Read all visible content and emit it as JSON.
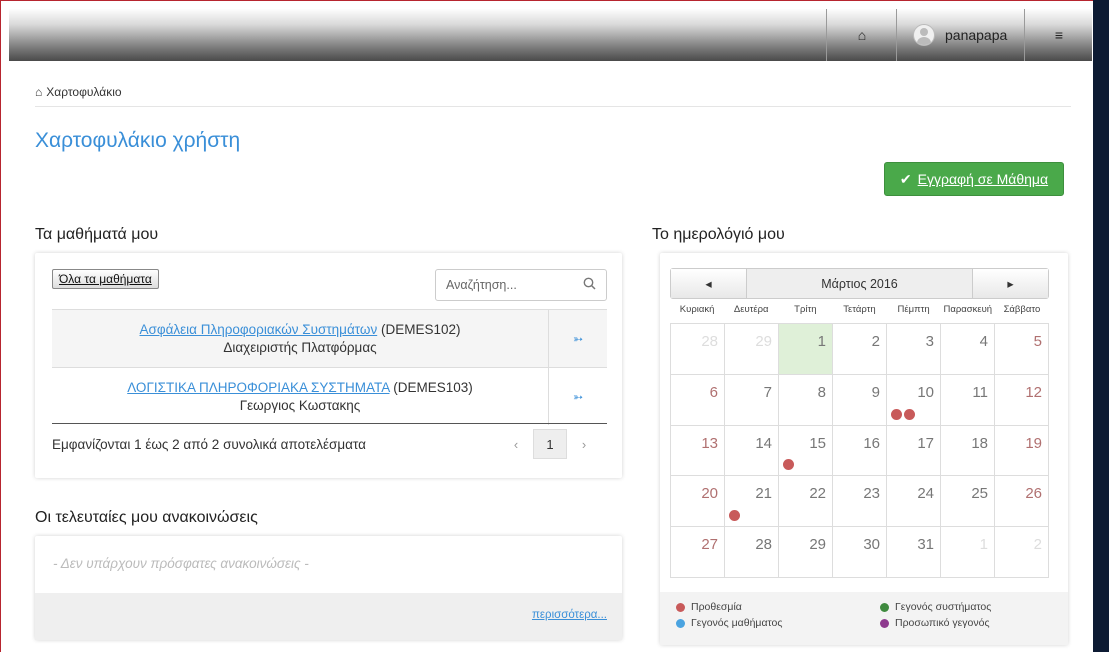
{
  "topbar": {
    "home_icon": "home-icon",
    "username": "panapapa",
    "settings_icon": "sliders-icon"
  },
  "breadcrumb": {
    "label": "Χαρτοφυλάκιο"
  },
  "page_title": "Χαρτοφυλάκιο χρήστη",
  "enroll_button": "Εγγραφή σε Μάθημα",
  "courses": {
    "heading": "Τα μαθήματά μου",
    "all_button": "Όλα τα μαθήματα",
    "search_placeholder": "Αναζήτηση...",
    "rows": [
      {
        "title": "Ασφάλεια Πληροφοριακών Συστημάτων",
        "code": "(DEMES102)",
        "instructor": "Διαχειριστής Πλατφόρμας"
      },
      {
        "title": "ΛΟΓΙΣΤΙΚΑ ΠΛΗΡΟΦΟΡΙΑΚΑ ΣΥΣΤΗΜΑΤΑ",
        "code": "(DEMES103)",
        "instructor": "Γεωργιος Κωστακης"
      }
    ],
    "results_text": "Εμφανίζονται 1 έως 2 από 2 συνολικά αποτελέσματα",
    "pager": {
      "prev": "‹",
      "current": "1",
      "next": "›"
    }
  },
  "announcements": {
    "heading": "Οι τελευταίες μου ανακοινώσεις",
    "empty": "- Δεν υπάρχουν πρόσφατες ανακοινώσεις -",
    "more": "περισσότερα..."
  },
  "calendar": {
    "heading": "Το ημερολόγιό μου",
    "prev": "◂",
    "next": "▸",
    "month": "Μάρτιος 2016",
    "weekdays": [
      "Κυριακή",
      "Δευτέρα",
      "Τρίτη",
      "Τετάρτη",
      "Πέμπτη",
      "Παρασκευή",
      "Σάββατο"
    ],
    "weeks": [
      [
        "28",
        "29",
        "1",
        "2",
        "3",
        "4",
        "5"
      ],
      [
        "6",
        "7",
        "8",
        "9",
        "10",
        "11",
        "12"
      ],
      [
        "13",
        "14",
        "15",
        "16",
        "17",
        "18",
        "19"
      ],
      [
        "20",
        "21",
        "22",
        "23",
        "24",
        "25",
        "26"
      ],
      [
        "27",
        "28",
        "29",
        "30",
        "31",
        "1",
        "2"
      ]
    ],
    "other_month_cells": [
      [
        0,
        0
      ],
      [
        0,
        1
      ],
      [
        4,
        5
      ],
      [
        4,
        6
      ]
    ],
    "today_cell": [
      0,
      2
    ],
    "deadline_events": [
      [
        1,
        4
      ],
      [
        1,
        4
      ],
      [
        2,
        2
      ],
      [
        3,
        1
      ]
    ],
    "legend": [
      {
        "label": "Προθεσμία",
        "color": "#c85a5a"
      },
      {
        "label": "Γεγονός συστήματος",
        "color": "#3f8a3f"
      },
      {
        "label": "Γεγονός μαθήματος",
        "color": "#4aa3e0"
      },
      {
        "label": "Προσωπικό γεγονός",
        "color": "#8e3a8e"
      }
    ]
  }
}
